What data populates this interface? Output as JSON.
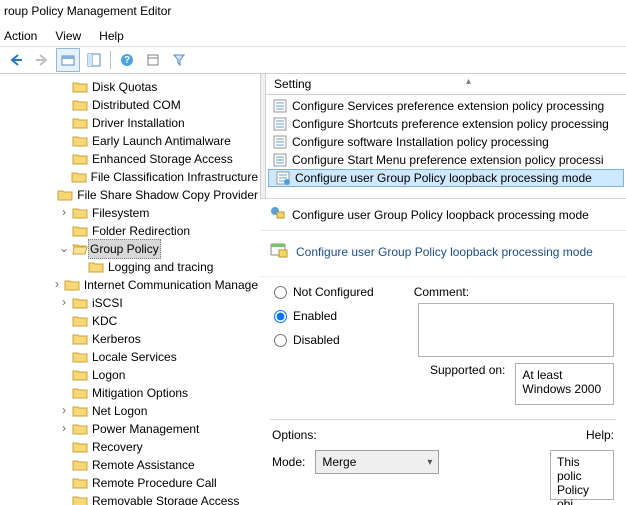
{
  "title": "roup Policy Management Editor",
  "menu": {
    "action": "Action",
    "view": "View",
    "help": "Help"
  },
  "tree": [
    {
      "indent": 3,
      "exp": "",
      "label": "Disk Quotas"
    },
    {
      "indent": 3,
      "exp": "",
      "label": "Distributed COM"
    },
    {
      "indent": 3,
      "exp": "",
      "label": "Driver Installation"
    },
    {
      "indent": 3,
      "exp": "",
      "label": "Early Launch Antimalware"
    },
    {
      "indent": 3,
      "exp": "",
      "label": "Enhanced Storage Access"
    },
    {
      "indent": 3,
      "exp": "",
      "label": "File Classification Infrastructure"
    },
    {
      "indent": 3,
      "exp": "",
      "label": "File Share Shadow Copy Provider"
    },
    {
      "indent": 3,
      "exp": ">",
      "label": "Filesystem"
    },
    {
      "indent": 3,
      "exp": "",
      "label": "Folder Redirection"
    },
    {
      "indent": 3,
      "exp": "v",
      "label": "Group Policy",
      "selected": true,
      "open": true
    },
    {
      "indent": 4,
      "exp": "",
      "label": "Logging and tracing"
    },
    {
      "indent": 3,
      "exp": ">",
      "label": "Internet Communication Manage"
    },
    {
      "indent": 3,
      "exp": ">",
      "label": "iSCSI"
    },
    {
      "indent": 3,
      "exp": "",
      "label": "KDC"
    },
    {
      "indent": 3,
      "exp": "",
      "label": "Kerberos"
    },
    {
      "indent": 3,
      "exp": "",
      "label": "Locale Services"
    },
    {
      "indent": 3,
      "exp": "",
      "label": "Logon"
    },
    {
      "indent": 3,
      "exp": "",
      "label": "Mitigation Options"
    },
    {
      "indent": 3,
      "exp": ">",
      "label": "Net Logon"
    },
    {
      "indent": 3,
      "exp": ">",
      "label": "Power Management"
    },
    {
      "indent": 3,
      "exp": "",
      "label": "Recovery"
    },
    {
      "indent": 3,
      "exp": "",
      "label": "Remote Assistance"
    },
    {
      "indent": 3,
      "exp": "",
      "label": "Remote Procedure Call"
    },
    {
      "indent": 3,
      "exp": "",
      "label": "Removable Storage Access"
    }
  ],
  "list": {
    "header": "Setting",
    "rows": [
      {
        "label": "Configure Services preference extension policy processing"
      },
      {
        "label": "Configure Shortcuts preference extension policy processing"
      },
      {
        "label": "Configure software Installation policy processing"
      },
      {
        "label": "Configure Start Menu preference extension policy processi"
      },
      {
        "label": "Configure user Group Policy loopback processing mode",
        "selected": true
      }
    ]
  },
  "dlg": {
    "winTitle": "Configure user Group Policy loopback processing mode",
    "heading": "Configure user Group Policy loopback processing mode",
    "r_nc": "Not Configured",
    "r_en": "Enabled",
    "r_di": "Disabled",
    "comment": "Comment:",
    "supported": "Supported on:",
    "supported_val": "At least Windows 2000",
    "options": "Options:",
    "help": "Help:",
    "mode": "Mode:",
    "mode_val": "Merge",
    "help_text": "This polic\nPolicy obj"
  }
}
